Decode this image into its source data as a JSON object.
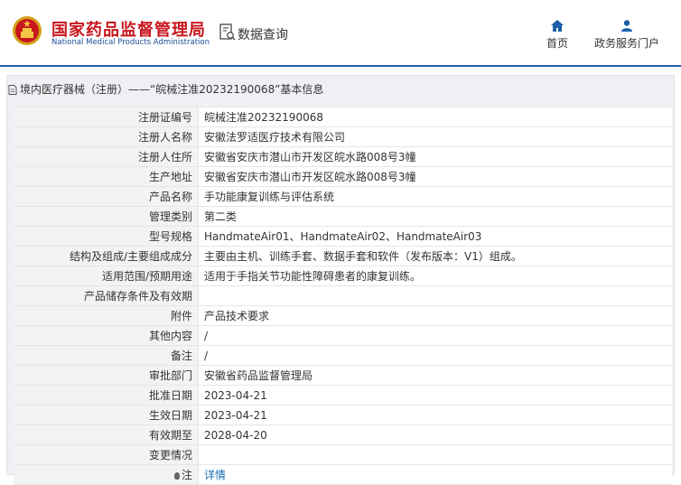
{
  "header": {
    "logo_cn": "国家药品监督管理局",
    "logo_en": "National Medical Products Administration",
    "search_label": "数据查询",
    "nav": [
      {
        "label": "首页",
        "icon": "home-icon"
      },
      {
        "label": "政务服务门户",
        "icon": "user-icon"
      }
    ]
  },
  "panel": {
    "title": "境内医疗器械（注册）——“皖械注准20232190068”基本信息"
  },
  "rows": [
    {
      "label": "注册证编号",
      "value": "皖械注准20232190068"
    },
    {
      "label": "注册人名称",
      "value": "安徽法罗适医疗技术有限公司"
    },
    {
      "label": "注册人住所",
      "value": "安徽省安庆市潜山市开发区皖水路008号3幢"
    },
    {
      "label": "生产地址",
      "value": "安徽省安庆市潜山市开发区皖水路008号3幢"
    },
    {
      "label": "产品名称",
      "value": "手功能康复训练与评估系统"
    },
    {
      "label": "管理类别",
      "value": "第二类"
    },
    {
      "label": "型号规格",
      "value": "HandmateAir01、HandmateAir02、HandmateAir03"
    },
    {
      "label": "结构及组成/主要组成成分",
      "value": "主要由主机、训练手套、数据手套和软件（发布版本：V1）组成。"
    },
    {
      "label": "适用范围/预期用途",
      "value": "适用于手指关节功能性障碍患者的康复训练。"
    },
    {
      "label": "产品储存条件及有效期",
      "value": ""
    },
    {
      "label": "附件",
      "value": "产品技术要求"
    },
    {
      "label": "其他内容",
      "value": "/"
    },
    {
      "label": "备注",
      "value": "/"
    },
    {
      "label": "审批部门",
      "value": "安徽省药品监督管理局"
    },
    {
      "label": "批准日期",
      "value": "2023-04-21"
    },
    {
      "label": "生效日期",
      "value": "2023-04-21"
    },
    {
      "label": "有效期至",
      "value": "2028-04-20"
    },
    {
      "label": "变更情况",
      "value": ""
    }
  ],
  "note": {
    "label": "注",
    "link": "详情"
  },
  "colors": {
    "accent": "#1b5fa8",
    "brand_red": "#c8161d",
    "link": "#1b6db5"
  }
}
